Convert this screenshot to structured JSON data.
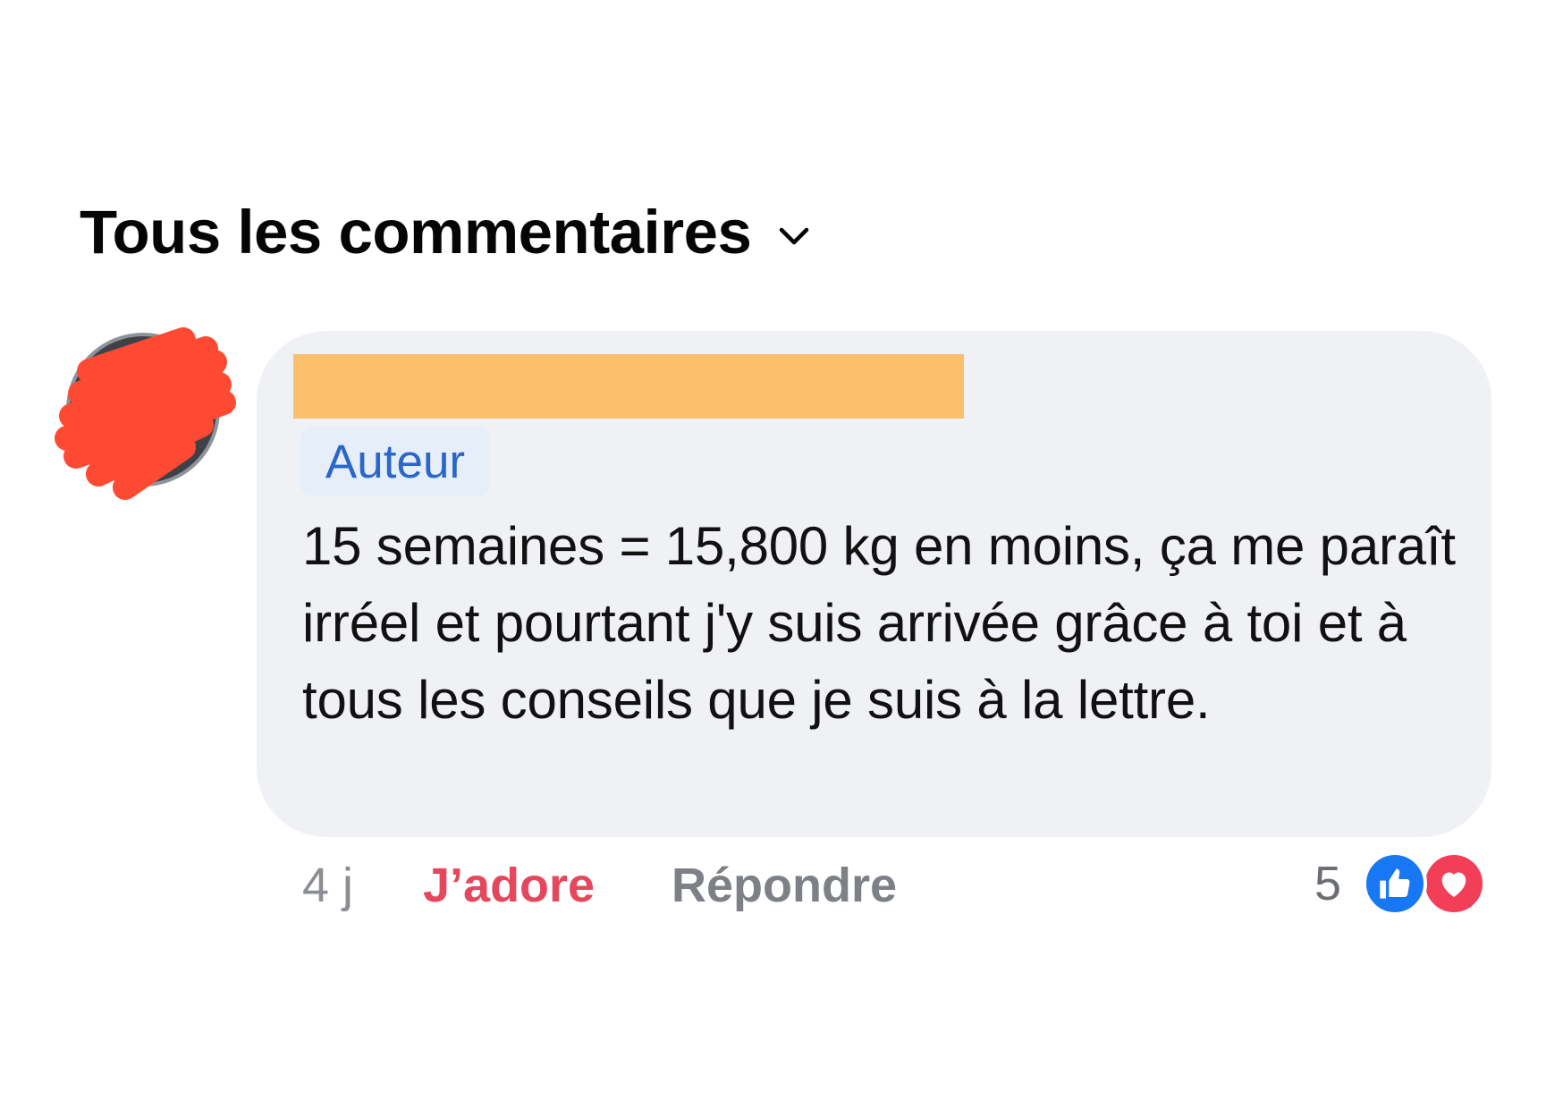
{
  "header": {
    "title": "Tous les commentaires",
    "chevron_icon": "chevron-down-icon"
  },
  "comment": {
    "author_badge": "Auteur",
    "text": "15 semaines = 15,800 kg en moins, ça me paraît irréel et pourtant j'y suis arrivée grâce à toi et à tous les conseils que je suis à la lettre.",
    "actions": {
      "time": "4 j",
      "love_label": "J’adore",
      "reply_label": "Répondre"
    },
    "reactions": {
      "count": "5",
      "icons": [
        "like-icon",
        "heart-icon"
      ]
    }
  },
  "colors": {
    "bubble_bg": "#f0f1f5",
    "name_redaction": "#fdbf6b",
    "avatar_scribble": "#ff4a33",
    "author_badge_text": "#2b67c9",
    "love_text": "#e5485d",
    "like_blue": "#1877f2",
    "heart_red": "#f33e58"
  }
}
